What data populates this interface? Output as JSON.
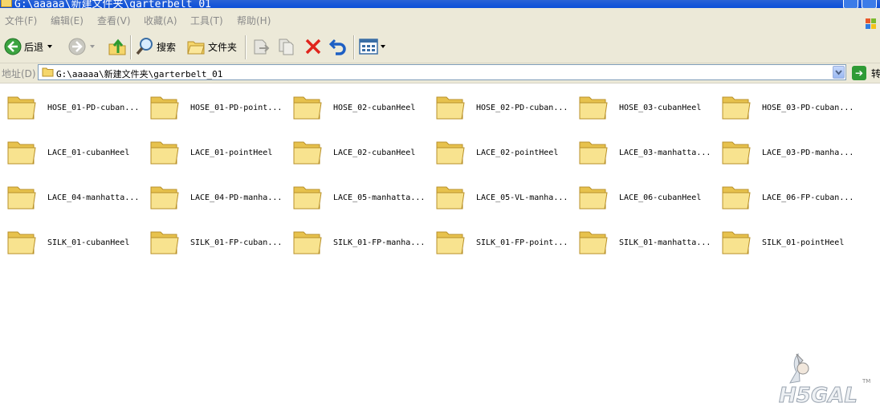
{
  "window": {
    "title": "G:\\aaaaa\\新建文件夹\\garterbelt_01"
  },
  "menu": [
    "文件(F)",
    "编辑(E)",
    "查看(V)",
    "收藏(A)",
    "工具(T)",
    "帮助(H)"
  ],
  "toolbar": {
    "back_label": "后退",
    "search_label": "搜索",
    "folders_label": "文件夹"
  },
  "address": {
    "label": "地址(D)",
    "value": "G:\\aaaaa\\新建文件夹\\garterbelt_01",
    "go_label": "转"
  },
  "icons": {
    "back": "back-arrow-icon",
    "forward": "forward-arrow-icon",
    "up": "up-folder-icon",
    "search": "search-magnifier-icon",
    "folders": "folders-icon",
    "move": "move-to-icon",
    "copy": "copy-to-icon",
    "delete": "delete-icon",
    "undo": "undo-icon",
    "views": "views-icon"
  },
  "folders": [
    [
      "HOSE_01-PD-cuban...",
      "HOSE_01-PD-point...",
      "HOSE_02-cubanHeel",
      "HOSE_02-PD-cuban...",
      "HOSE_03-cubanHeel",
      "HOSE_03-PD-cuban..."
    ],
    [
      "LACE_01-cubanHeel",
      "LACE_01-pointHeel",
      "LACE_02-cubanHeel",
      "LACE_02-pointHeel",
      "LACE_03-manhatta...",
      "LACE_03-PD-manha..."
    ],
    [
      "LACE_04-manhatta...",
      "LACE_04-PD-manha...",
      "LACE_05-manhatta...",
      "LACE_05-VL-manha...",
      "LACE_06-cubanHeel",
      "LACE_06-FP-cuban..."
    ],
    [
      "SILK_01-cubanHeel",
      "SILK_01-FP-cuban...",
      "SILK_01-FP-manha...",
      "SILK_01-FP-point...",
      "SILK_01-manhatta...",
      "SILK_01-pointHeel"
    ]
  ],
  "watermark": {
    "text": "H5GAL",
    "tm": "TM"
  },
  "colors": {
    "chrome": "#ece9d8",
    "titlebar": "#0b4fd8",
    "folder": "#f6dd7a"
  }
}
